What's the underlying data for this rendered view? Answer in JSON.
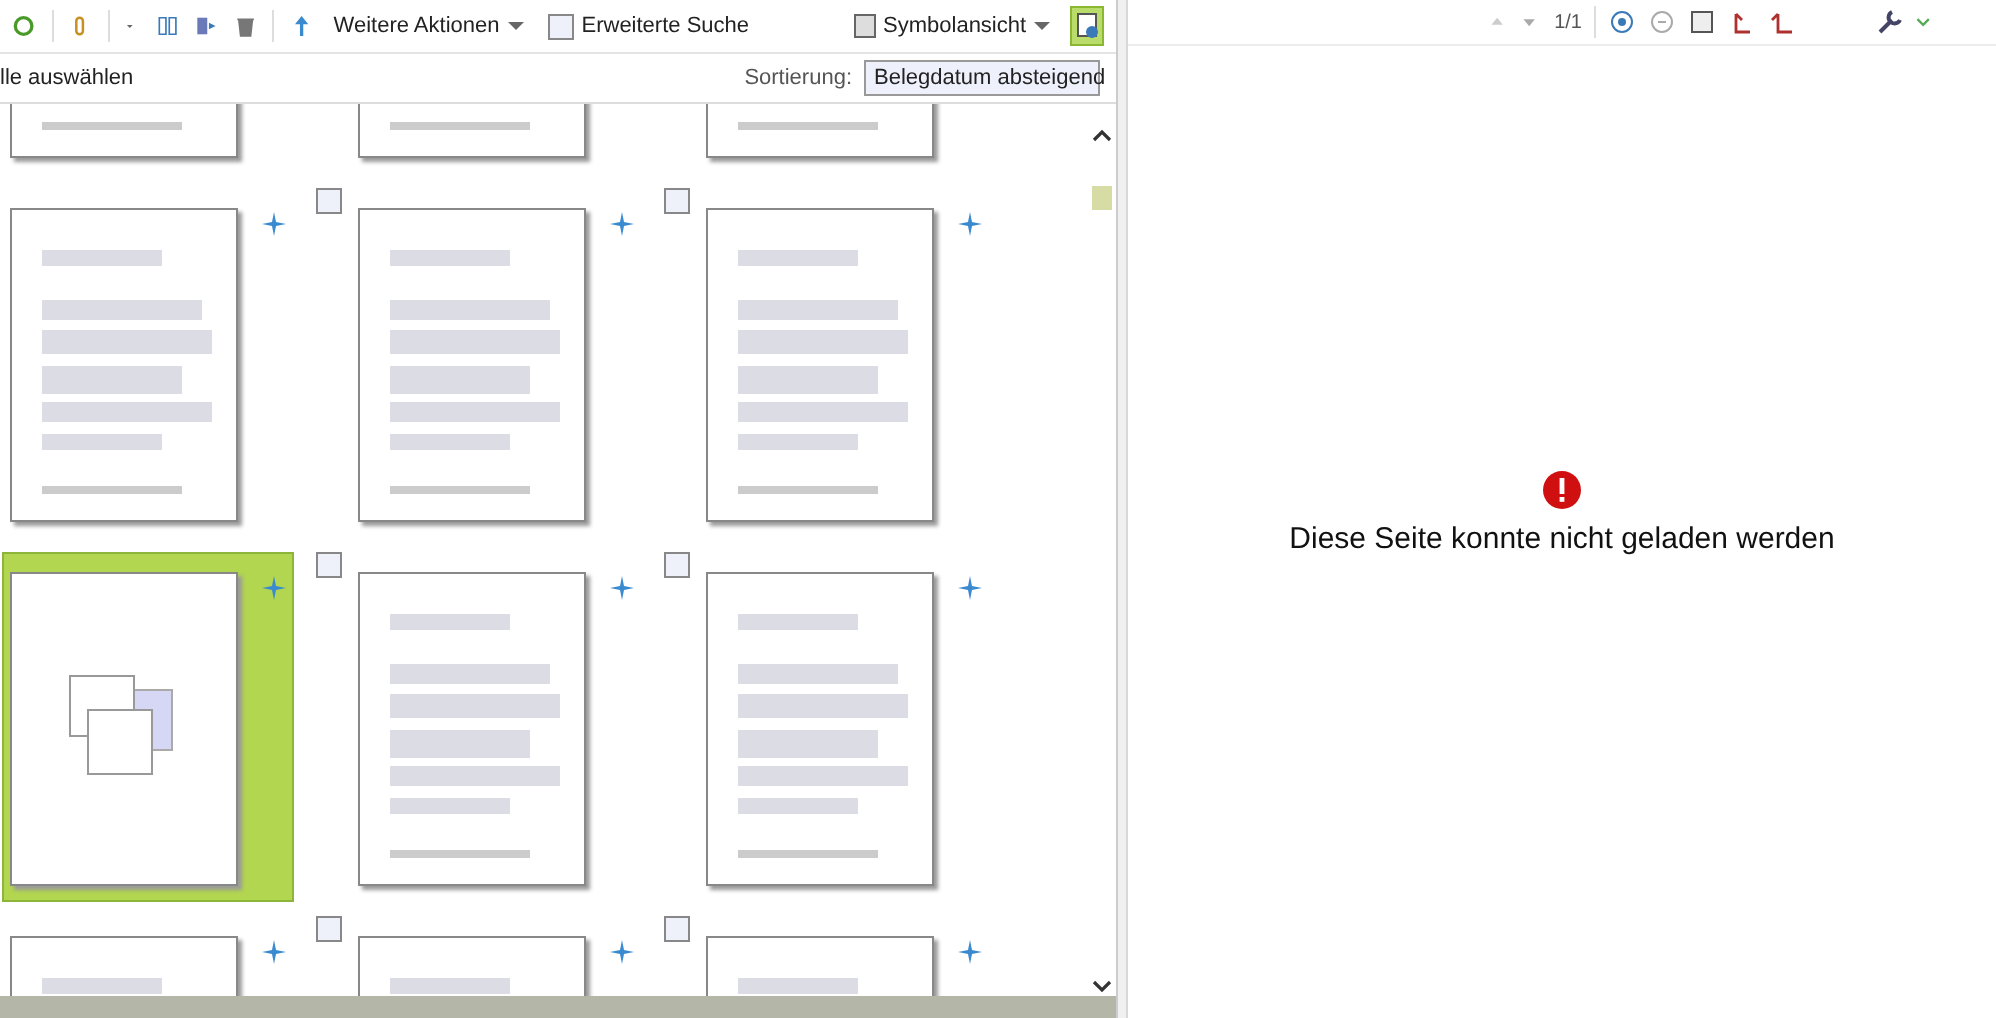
{
  "toolbar": {
    "more_actions": "Weitere Aktionen",
    "advanced_search": {
      "label": "Erweiterte Suche",
      "checked": false
    },
    "view": "Symbolansicht",
    "scan_active": true
  },
  "list_header": {
    "select_all": "lle auswählen",
    "sort_label": "Sortierung:",
    "sort_value": "Belegdatum absteigend"
  },
  "documents": [
    {
      "kind": "scan",
      "selected": false
    },
    {
      "kind": "scan",
      "selected": false
    },
    {
      "kind": "scan",
      "selected": false
    },
    {
      "kind": "scan",
      "selected": false
    },
    {
      "kind": "scan",
      "selected": false,
      "checked": false
    },
    {
      "kind": "scan",
      "selected": false,
      "checked": false
    },
    {
      "kind": "placeholder",
      "selected": true
    },
    {
      "kind": "scan",
      "selected": false,
      "checked": false
    },
    {
      "kind": "scan",
      "selected": false,
      "checked": false
    },
    {
      "kind": "scan",
      "selected": false
    },
    {
      "kind": "scan",
      "selected": false,
      "checked": false
    },
    {
      "kind": "scan",
      "selected": false,
      "checked": false
    }
  ],
  "viewer": {
    "page": "1/1",
    "error": "Diese Seite konnte nicht geladen werden"
  }
}
